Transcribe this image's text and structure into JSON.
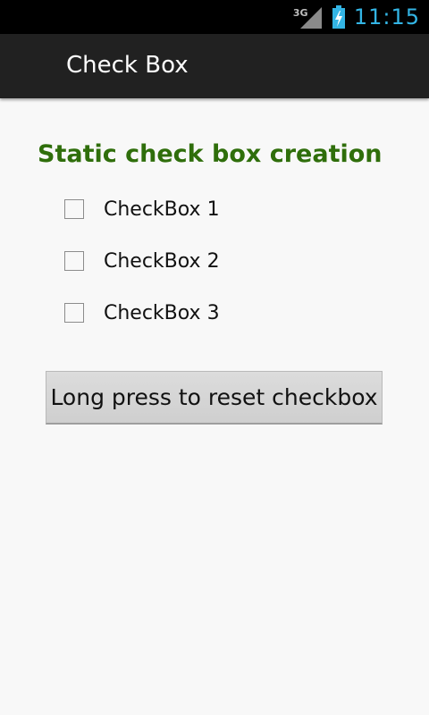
{
  "status_bar": {
    "network_label": "3G",
    "time": "11:15",
    "icons": [
      "signal-icon",
      "battery-charging-icon"
    ],
    "clock_color": "#33b5e5"
  },
  "action_bar": {
    "title": "Check Box"
  },
  "main": {
    "section_title": "Static check box creation",
    "section_title_color": "#2f6e0b",
    "checkboxes": [
      {
        "label": "CheckBox 1",
        "checked": false
      },
      {
        "label": "CheckBox 2",
        "checked": false
      },
      {
        "label": "CheckBox 3",
        "checked": false
      }
    ],
    "reset_button_label": "Long press to reset checkbox"
  }
}
